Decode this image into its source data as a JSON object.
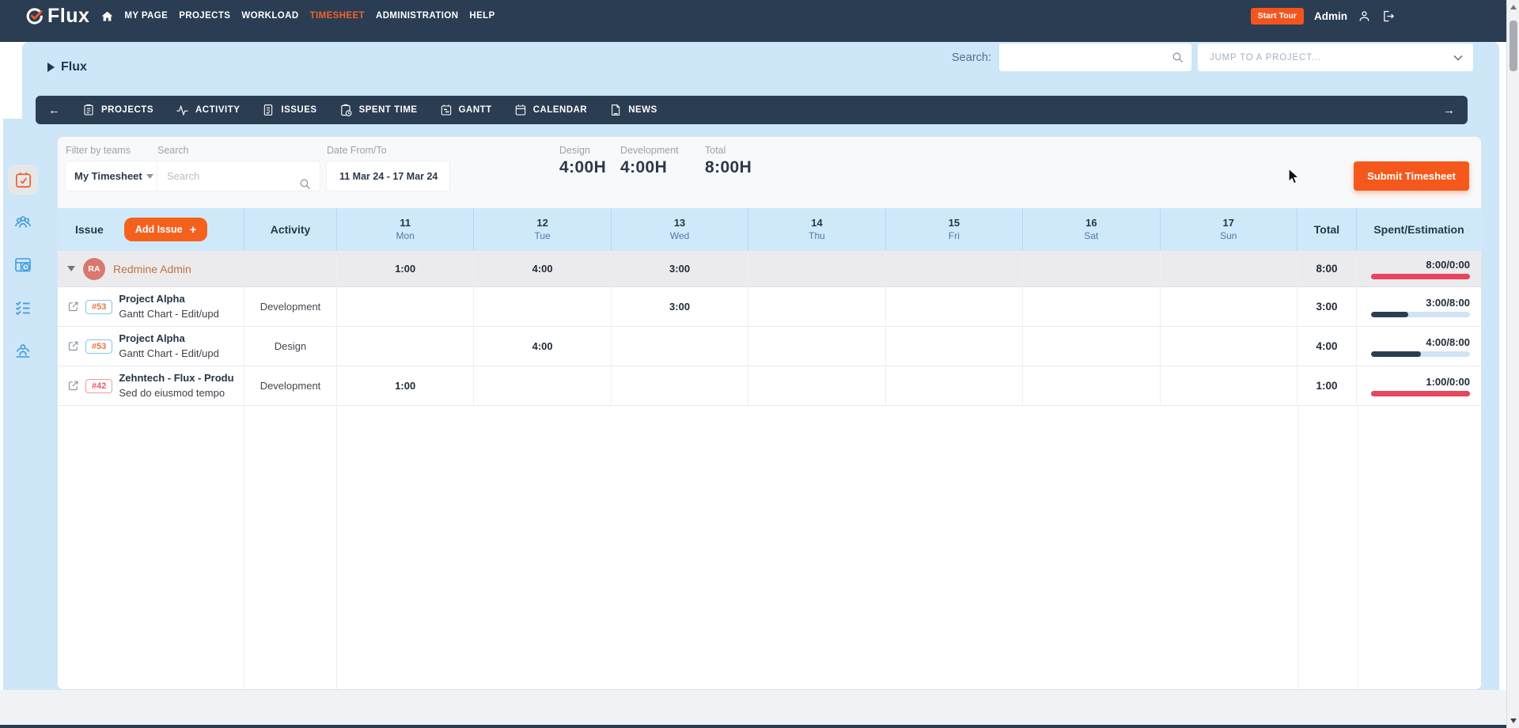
{
  "colors": {
    "accent": "#ef5a1f",
    "navy": "#2b3d52",
    "panel_blue": "#cde6f8",
    "header_blue": "#cfe9fb",
    "crimson": "#e8455f",
    "bar_track_blue": "#cfe4f5",
    "avatar_bg": "#d9796e"
  },
  "icons": {
    "logo": "circle-check-icon",
    "topnav": [
      "home-icon",
      "user-icon",
      "logout-icon"
    ],
    "subnav": [
      "clipboard-icon",
      "pulse-icon",
      "document-check-icon",
      "clock-clipboard-icon",
      "gantt-icon",
      "calendar-icon",
      "news-icon"
    ],
    "sidebar": [
      "timesheet-calendar-icon",
      "teams-icon",
      "workload-board-icon",
      "checklist-icon",
      "meeting-icon"
    ],
    "misc": [
      "search-icon",
      "chevron-down-icon",
      "caret-down-icon",
      "external-link-icon",
      "cursor-arrow"
    ]
  },
  "topnav": {
    "logo": "Flux",
    "items": [
      {
        "label": "MY PAGE"
      },
      {
        "label": "PROJECTS"
      },
      {
        "label": "WORKLOAD"
      },
      {
        "label": "TIMESHEET"
      },
      {
        "label": "ADMINISTRATION"
      },
      {
        "label": "HELP"
      }
    ],
    "start_tour": "Start Tour",
    "user": "Admin"
  },
  "header": {
    "breadcrumb": "Flux",
    "search_label": "Search:",
    "search_value": "",
    "jump_placeholder": "JUMP TO A PROJECT..."
  },
  "subnav": [
    {
      "label": "PROJECTS"
    },
    {
      "label": "ACTIVITY"
    },
    {
      "label": "ISSUES"
    },
    {
      "label": "SPENT TIME"
    },
    {
      "label": "GANTT"
    },
    {
      "label": "CALENDAR"
    },
    {
      "label": "NEWS"
    }
  ],
  "filters": {
    "team_label": "Filter by teams",
    "team_value": "My Timesheet",
    "search_label": "Search",
    "search_placeholder": "Search",
    "date_label": "Date From/To",
    "date_value": "11 Mar 24 - 17 Mar 24"
  },
  "stats": [
    {
      "label": "Design",
      "value": "4:00H"
    },
    {
      "label": "Development",
      "value": "4:00H"
    },
    {
      "label": "Total",
      "value": "8:00H"
    }
  ],
  "actions": {
    "submit": "Submit Timesheet"
  },
  "table": {
    "issue_header": "Issue",
    "add_issue": "Add Issue",
    "add_issue_plus": "+",
    "activity_header": "Activity",
    "total_header": "Total",
    "spent_header": "Spent/Estimation",
    "days": [
      {
        "num": "11",
        "name": "Mon"
      },
      {
        "num": "12",
        "name": "Tue"
      },
      {
        "num": "13",
        "name": "Wed"
      },
      {
        "num": "14",
        "name": "Thu"
      },
      {
        "num": "15",
        "name": "Fri"
      },
      {
        "num": "16",
        "name": "Sat"
      },
      {
        "num": "17",
        "name": "Sun"
      }
    ],
    "group": {
      "initials": "RA",
      "name": "Redmine Admin",
      "cells": [
        "1:00",
        "4:00",
        "3:00",
        "",
        "",
        "",
        ""
      ],
      "total": "8:00",
      "spent": "8:00/0:00",
      "progress": 100,
      "bar": "#e8455f",
      "track": "#e8455f"
    },
    "rows": [
      {
        "id": "#53",
        "badge_color": "#e8793c",
        "badge_border": "#83c7ec",
        "project": "Project Alpha",
        "subject": "Gantt Chart - Edit/upd",
        "activity": "Development",
        "cells": [
          "",
          "",
          "3:00",
          "",
          "",
          "",
          ""
        ],
        "total": "3:00",
        "spent": "3:00/8:00",
        "progress": 37.5,
        "bar": "#2b3d52",
        "track": "#cfe4f5"
      },
      {
        "id": "#53",
        "badge_color": "#e8793c",
        "badge_border": "#83c7ec",
        "project": "Project Alpha",
        "subject": "Gantt Chart - Edit/upd",
        "activity": "Design",
        "cells": [
          "",
          "4:00",
          "",
          "",
          "",
          "",
          ""
        ],
        "total": "4:00",
        "spent": "4:00/8:00",
        "progress": 50,
        "bar": "#2b3d52",
        "track": "#cfe4f5"
      },
      {
        "id": "#42",
        "badge_color": "#e85866",
        "badge_border": "#f29aa4",
        "project": "Zehntech - Flux - Produ",
        "subject": "Sed do eiusmod tempo",
        "activity": "Development",
        "cells": [
          "1:00",
          "",
          "",
          "",
          "",
          "",
          ""
        ],
        "total": "1:00",
        "spent": "1:00/0:00",
        "progress": 100,
        "bar": "#e8455f",
        "track": "#e8455f"
      }
    ]
  }
}
